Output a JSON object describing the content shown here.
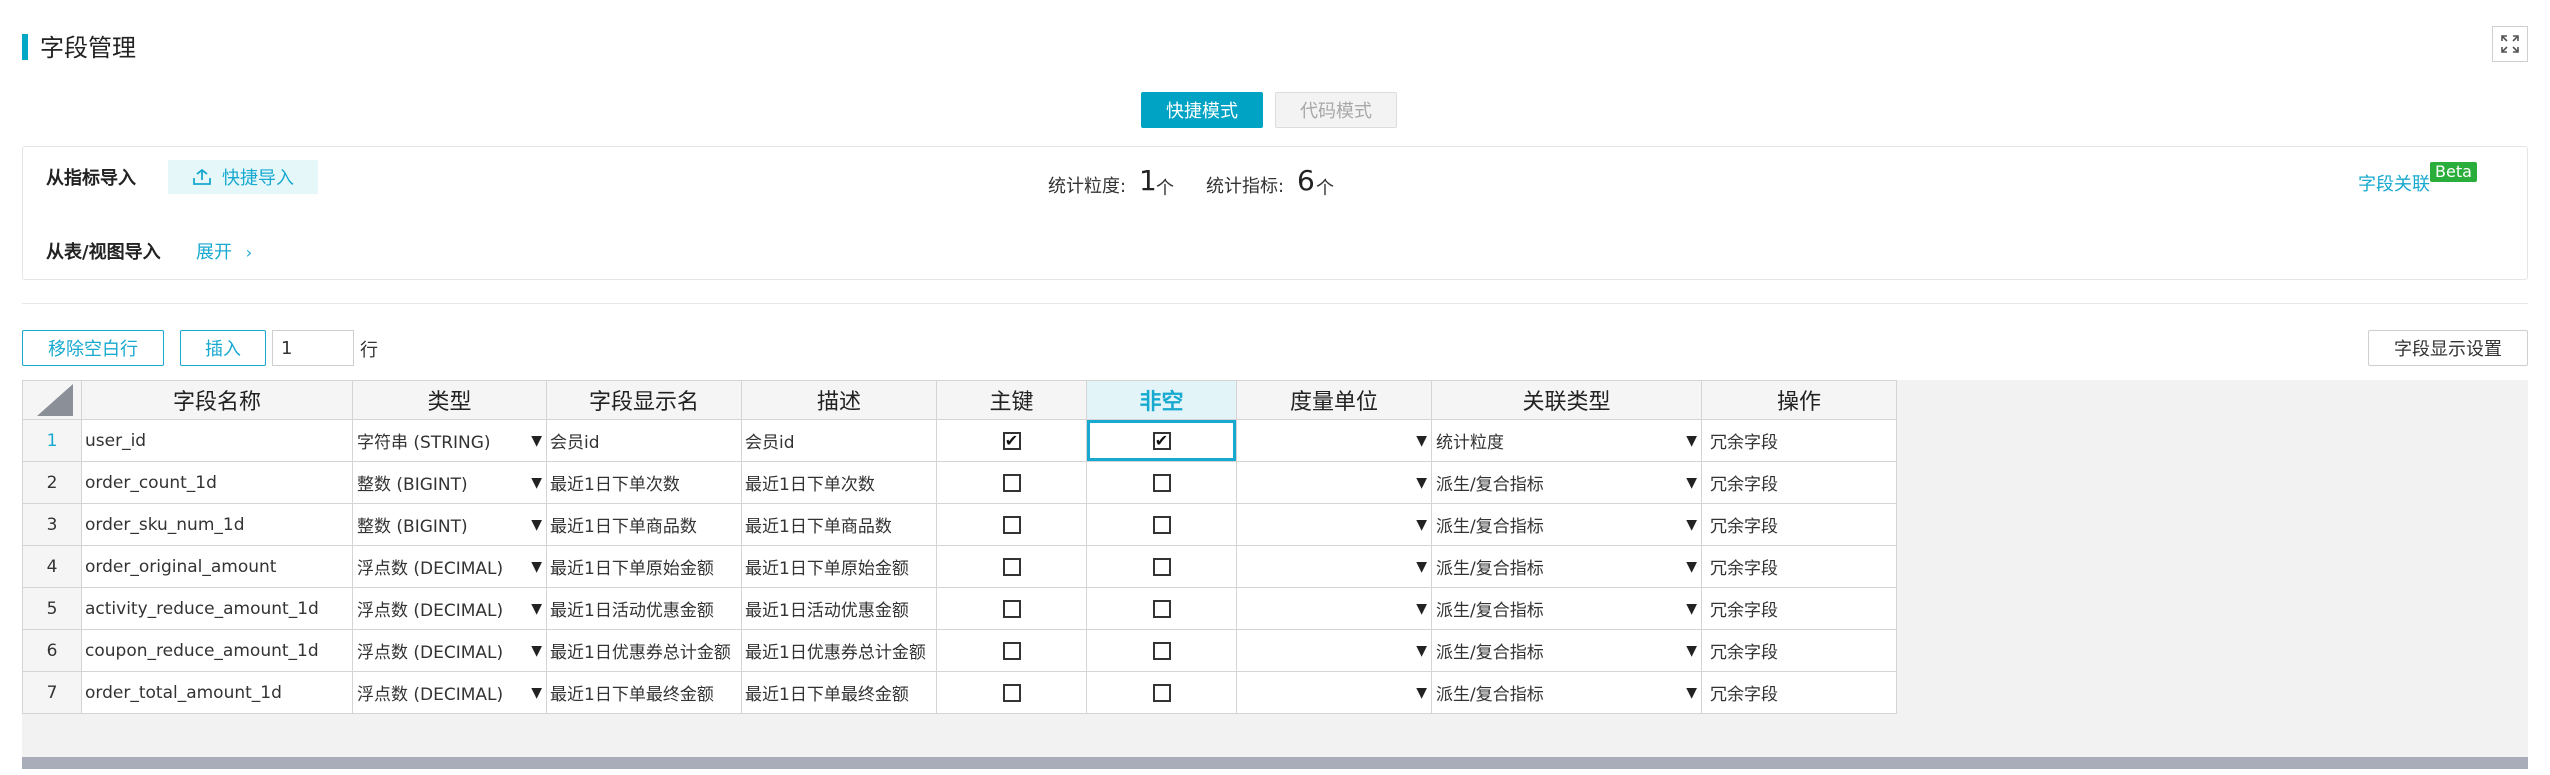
{
  "title": "字段管理",
  "modes": {
    "quick": "快捷模式",
    "code": "代码模式"
  },
  "import": {
    "from_metric_label": "从指标导入",
    "quick_import": "快捷导入",
    "from_table_label": "从表/视图导入",
    "expand": "展开",
    "granularity_label": "统计粒度:",
    "granularity_value": "1",
    "granularity_unit": "个",
    "metric_label": "统计指标:",
    "metric_value": "6",
    "metric_unit": "个",
    "field_link": "字段关联",
    "beta": "Beta"
  },
  "toolbar": {
    "remove_empty": "移除空白行",
    "insert": "插入",
    "row_count": "1",
    "row_unit": "行",
    "display_settings": "字段显示设置"
  },
  "columns": [
    "字段名称",
    "类型",
    "字段显示名",
    "描述",
    "主键",
    "非空",
    "度量单位",
    "关联类型",
    "操作"
  ],
  "rows": [
    {
      "n": "1",
      "name": "user_id",
      "type": "字符串 (STRING)",
      "display": "会员id",
      "desc": "会员id",
      "pk": true,
      "notnull": true,
      "unit": "",
      "rel": "统计粒度",
      "op": "冗余字段"
    },
    {
      "n": "2",
      "name": "order_count_1d",
      "type": "整数 (BIGINT)",
      "display": "最近1日下单次数",
      "desc": "最近1日下单次数",
      "pk": false,
      "notnull": false,
      "unit": "",
      "rel": "派生/复合指标",
      "op": "冗余字段"
    },
    {
      "n": "3",
      "name": "order_sku_num_1d",
      "type": "整数 (BIGINT)",
      "display": "最近1日下单商品数",
      "desc": "最近1日下单商品数",
      "pk": false,
      "notnull": false,
      "unit": "",
      "rel": "派生/复合指标",
      "op": "冗余字段"
    },
    {
      "n": "4",
      "name": "order_original_amount",
      "type": "浮点数 (DECIMAL)",
      "display": "最近1日下单原始金额",
      "desc": "最近1日下单原始金额",
      "pk": false,
      "notnull": false,
      "unit": "",
      "rel": "派生/复合指标",
      "op": "冗余字段"
    },
    {
      "n": "5",
      "name": "activity_reduce_amount_1d",
      "type": "浮点数 (DECIMAL)",
      "display": "最近1日活动优惠金额",
      "desc": "最近1日活动优惠金额",
      "pk": false,
      "notnull": false,
      "unit": "",
      "rel": "派生/复合指标",
      "op": "冗余字段"
    },
    {
      "n": "6",
      "name": "coupon_reduce_amount_1d",
      "type": "浮点数 (DECIMAL)",
      "display": "最近1日优惠券总计金额",
      "desc": "最近1日优惠券总计金额",
      "pk": false,
      "notnull": false,
      "unit": "",
      "rel": "派生/复合指标",
      "op": "冗余字段"
    },
    {
      "n": "7",
      "name": "order_total_amount_1d",
      "type": "浮点数 (DECIMAL)",
      "display": "最近1日下单最终金额",
      "desc": "最近1日下单最终金额",
      "pk": false,
      "notnull": false,
      "unit": "",
      "rel": "派生/复合指标",
      "op": "冗余字段"
    }
  ],
  "colors": {
    "accent": "#17a9cf",
    "primary_button": "#00a3c4",
    "beta": "#2aae3b"
  }
}
